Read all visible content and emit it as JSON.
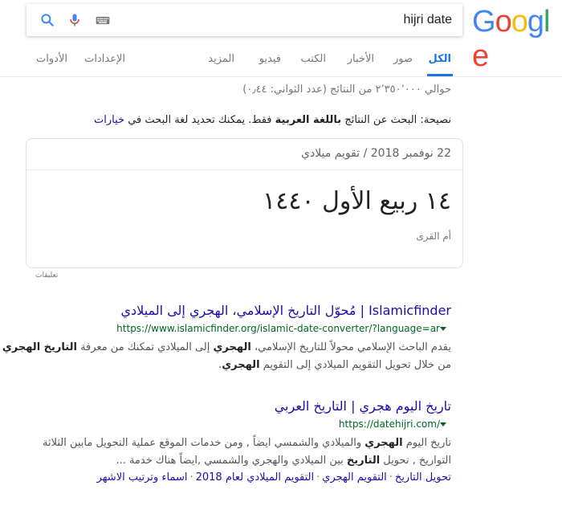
{
  "logo": {
    "letters": [
      "G",
      "o",
      "o",
      "g",
      "l",
      "e"
    ],
    "colors": [
      "#4285f4",
      "#ea4335",
      "#fbbc05",
      "#4285f4",
      "#34a853",
      "#ea4335"
    ]
  },
  "search": {
    "value": "hijri date",
    "icons": [
      "keyboard-icon",
      "microphone-icon",
      "search-icon"
    ]
  },
  "tabs": {
    "all": "الكل",
    "images": "صور",
    "news": "الأخبار",
    "books": "الكتب",
    "videos": "فيديو",
    "more": "المزيد",
    "settings": "الإعدادات",
    "tools": "الأدوات",
    "active_color": "#1a73e8"
  },
  "stats": "حوالي ٢٬٣٥٠٬٠٠٠ من النتائج (عدد الثواني: ٠٫٤٤)",
  "tip": {
    "prefix": "نصيحة: ",
    "text1": "البحث عن النتائج ",
    "bold": "باللغة العربية",
    "text2": " فقط. يمكنك تحديد لغة البحث في ",
    "link": "خيارات"
  },
  "card": {
    "header": "22 نوفمبر 2018 / تقويم ميلادي",
    "main": "١٤ ربيع الأول ١٤٤٠",
    "sub": "أم القرى"
  },
  "feedback": "تعليقات",
  "results": [
    {
      "title": "Islamicfinder | مُحوّل التاريخ الإسلامي، الهجري إلى الميلادي",
      "url": "https://www.islamicfinder.org/islamic-date-converter/?language=ar",
      "snippet": [
        {
          "a": "يقدم الباحث الإسلامي محولاً للتاريخ الإسلامي، ",
          "b": "الهجري",
          "c": " إلى الميلادي تمكنك من معرفة ",
          "d": "التاريخ الهجري"
        },
        {
          "a": "من خلال تحويل التقويم الميلادي إلى التقويم ",
          "b": "الهجري",
          "c": ".",
          "d": ""
        }
      ]
    },
    {
      "title": "تاريخ اليوم هجري | التاريخ العربي",
      "url": "https://datehijri.com/",
      "snippet": [
        {
          "a": "تاريخ اليوم ",
          "b": "الهجري",
          "c": " والميلادي والشمسي ايضاً , ومن خدمات الموقع عملية التحويل مابين الثلاثة",
          "d": ""
        },
        {
          "a": "التواريخ , تحويل ",
          "b": "التاريخ",
          "c": " بين الميلادي والهجري والشمسي ,ايضاً هناك خدمة ...",
          "d": ""
        }
      ],
      "links": [
        "تحويل التاريخ",
        "التقويم الهجري",
        "التقويم الميلادي لعام 2018",
        "اسماء وترتيب الاشهر"
      ]
    }
  ]
}
